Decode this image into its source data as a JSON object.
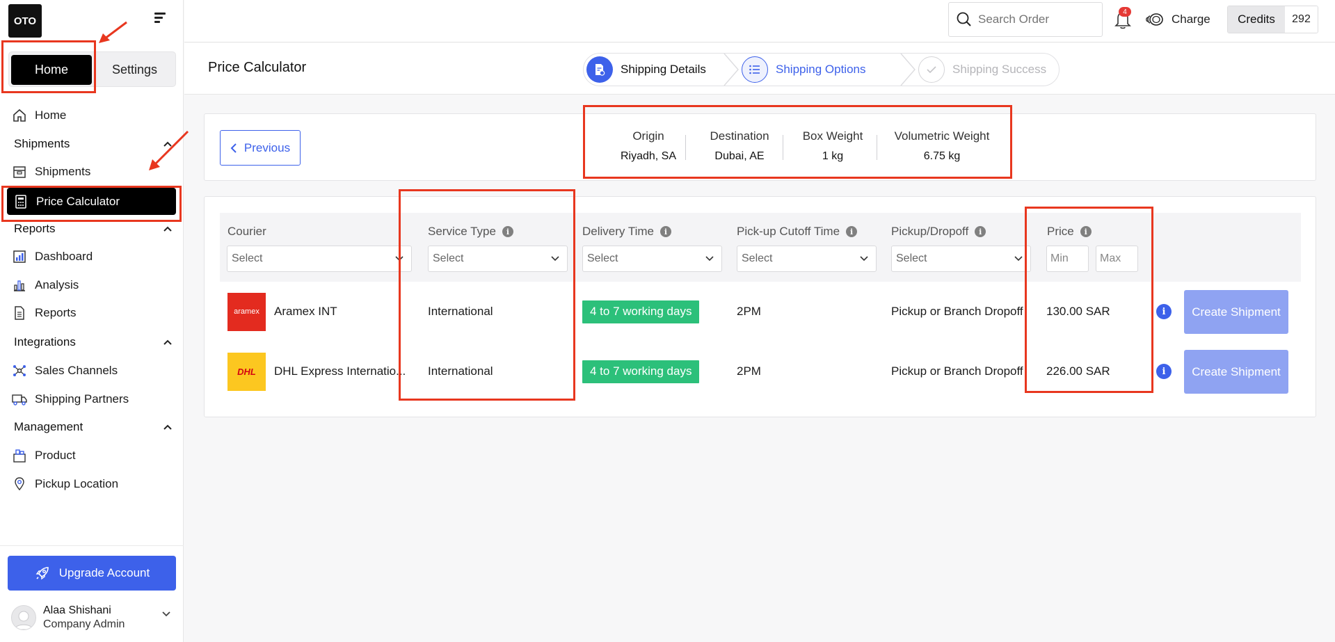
{
  "app": {
    "logo_text": "OTO"
  },
  "sidebar": {
    "toggle": {
      "home": "Home",
      "settings": "Settings"
    },
    "items": {
      "home": "Home",
      "shipments_section": "Shipments",
      "shipments": "Shipments",
      "price_calculator": "Price Calculator",
      "reports_section": "Reports",
      "dashboard": "Dashboard",
      "analysis": "Analysis",
      "reports": "Reports",
      "integrations_section": "Integrations",
      "sales_channels": "Sales Channels",
      "shipping_partners": "Shipping Partners",
      "management_section": "Management",
      "product": "Product",
      "pickup_location": "Pickup Location"
    },
    "upgrade": "Upgrade Account",
    "user": {
      "name": "Alaa Shishani",
      "role": "Company Admin"
    }
  },
  "topbar": {
    "search_placeholder": "Search Order",
    "notifications_count": "4",
    "charge": "Charge",
    "credits_label": "Credits",
    "credits_value": "292"
  },
  "header": {
    "title": "Price Calculator",
    "steps": [
      {
        "label": "Shipping Details",
        "state": "done"
      },
      {
        "label": "Shipping Options",
        "state": "active"
      },
      {
        "label": "Shipping Success",
        "state": "pending"
      }
    ]
  },
  "summary": {
    "previous": "Previous",
    "stats": [
      {
        "label": "Origin",
        "value": "Riyadh, SA"
      },
      {
        "label": "Destination",
        "value": "Dubai, AE"
      },
      {
        "label": "Box Weight",
        "value": "1 kg"
      },
      {
        "label": "Volumetric Weight",
        "value": "6.75 kg"
      }
    ]
  },
  "table": {
    "columns": {
      "courier": "Courier",
      "service_type": "Service Type",
      "delivery_time": "Delivery Time",
      "cutoff": "Pick-up Cutoff Time",
      "pickup": "Pickup/Dropoff",
      "price": "Price"
    },
    "filters": {
      "select": "Select",
      "min": "Min",
      "max": "Max"
    },
    "rows": [
      {
        "courier": "Aramex INT",
        "logo_text": "aramex",
        "service_type": "International",
        "delivery_time": "4 to 7 working days",
        "cutoff": "2PM",
        "pickup": "Pickup or Branch Dropoff",
        "price": "130.00 SAR",
        "action": "Create Shipment"
      },
      {
        "courier": "DHL Express Internatio...",
        "logo_text": "DHL",
        "service_type": "International",
        "delivery_time": "4 to 7 working days",
        "cutoff": "2PM",
        "pickup": "Pickup or Branch Dropoff",
        "price": "226.00 SAR",
        "action": "Create Shipment"
      }
    ]
  },
  "colors": {
    "primary": "#3d61ea",
    "chip_green": "#2cc07a",
    "annotation_red": "#e8371f",
    "aramex_red": "#e32b1f",
    "dhl_yellow": "#fcc720"
  }
}
